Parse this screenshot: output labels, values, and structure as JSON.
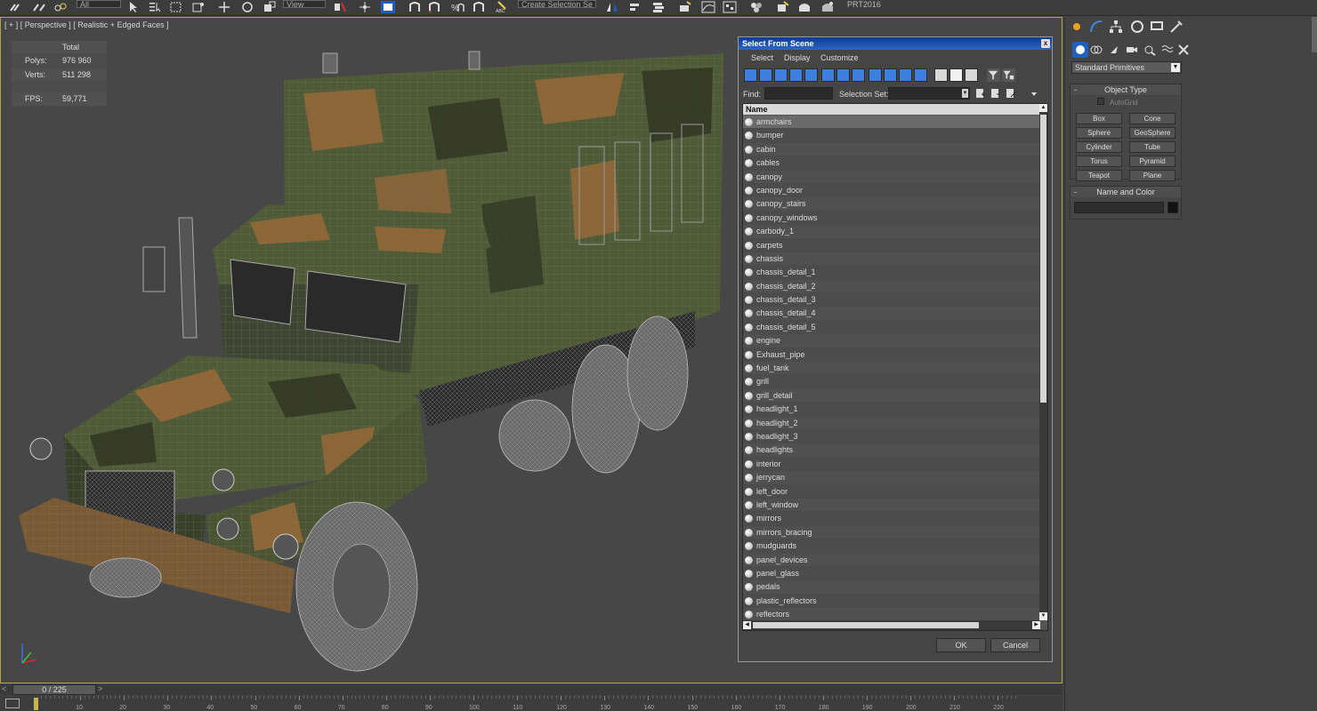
{
  "toolbar": {
    "project_label": "PRT2016",
    "view_dropdown": "View",
    "selection_set_dropdown": "Create Selection Se",
    "filter_dropdown": "All"
  },
  "viewport": {
    "label": "[ + ] [ Perspective ] [ Realistic + Edged Faces ]",
    "stats": {
      "total_label": "Total",
      "polys_label": "Polys:",
      "polys_value": "976 960",
      "verts_label": "Verts:",
      "verts_value": "511 298",
      "fps_label": "FPS:",
      "fps_value": "59,771"
    }
  },
  "timeline": {
    "slider_label": "0 / 225",
    "prev": "<",
    "next": ">",
    "ticks": [
      "10",
      "20",
      "30",
      "40",
      "50",
      "60",
      "70",
      "80",
      "90",
      "100",
      "110",
      "120",
      "130",
      "140",
      "150",
      "160",
      "170",
      "180",
      "190",
      "200",
      "210",
      "220"
    ]
  },
  "command_panel": {
    "dropdown": "Standard Primitives",
    "object_type": {
      "title": "Object Type",
      "autogrid": "AutoGrid",
      "buttons": [
        "Box",
        "Cone",
        "Sphere",
        "GeoSphere",
        "Cylinder",
        "Tube",
        "Torus",
        "Pyramid",
        "Teapot",
        "Plane"
      ]
    },
    "name_color": {
      "title": "Name and Color"
    }
  },
  "dialog": {
    "title": "Select From Scene",
    "close": "x",
    "menu": [
      "Select",
      "Display",
      "Customize"
    ],
    "find_label": "Find:",
    "selection_set_label": "Selection Set:",
    "column_header": "Name",
    "ok": "OK",
    "cancel": "Cancel",
    "items": [
      "armchairs",
      "bumper",
      "cabin",
      "cables",
      "canopy",
      "canopy_door",
      "canopy_stairs",
      "canopy_windows",
      "carbody_1",
      "carpets",
      "chassis",
      "chassis_detail_1",
      "chassis_detail_2",
      "chassis_detail_3",
      "chassis_detail_4",
      "chassis_detail_5",
      "engine",
      "Exhaust_pipe",
      "fuel_tank",
      "grill",
      "grill_detail",
      "headlight_1",
      "headlight_2",
      "headlight_3",
      "headlights",
      "interior",
      "jerrycan",
      "left_door",
      "left_window",
      "mirrors",
      "mirrors_bracing",
      "mudguards",
      "panel_devices",
      "panel_glass",
      "pedals",
      "plastic_reflectors",
      "reflectors"
    ],
    "selected_item": "armchairs"
  },
  "colors": {
    "viewport_bg": "#474747",
    "stats_text": "#e8d34a",
    "title_bar": "#1c4fa8",
    "camo_green": "#4f5a36",
    "camo_brown": "#9a6a3a",
    "camo_dark": "#2f3322"
  }
}
